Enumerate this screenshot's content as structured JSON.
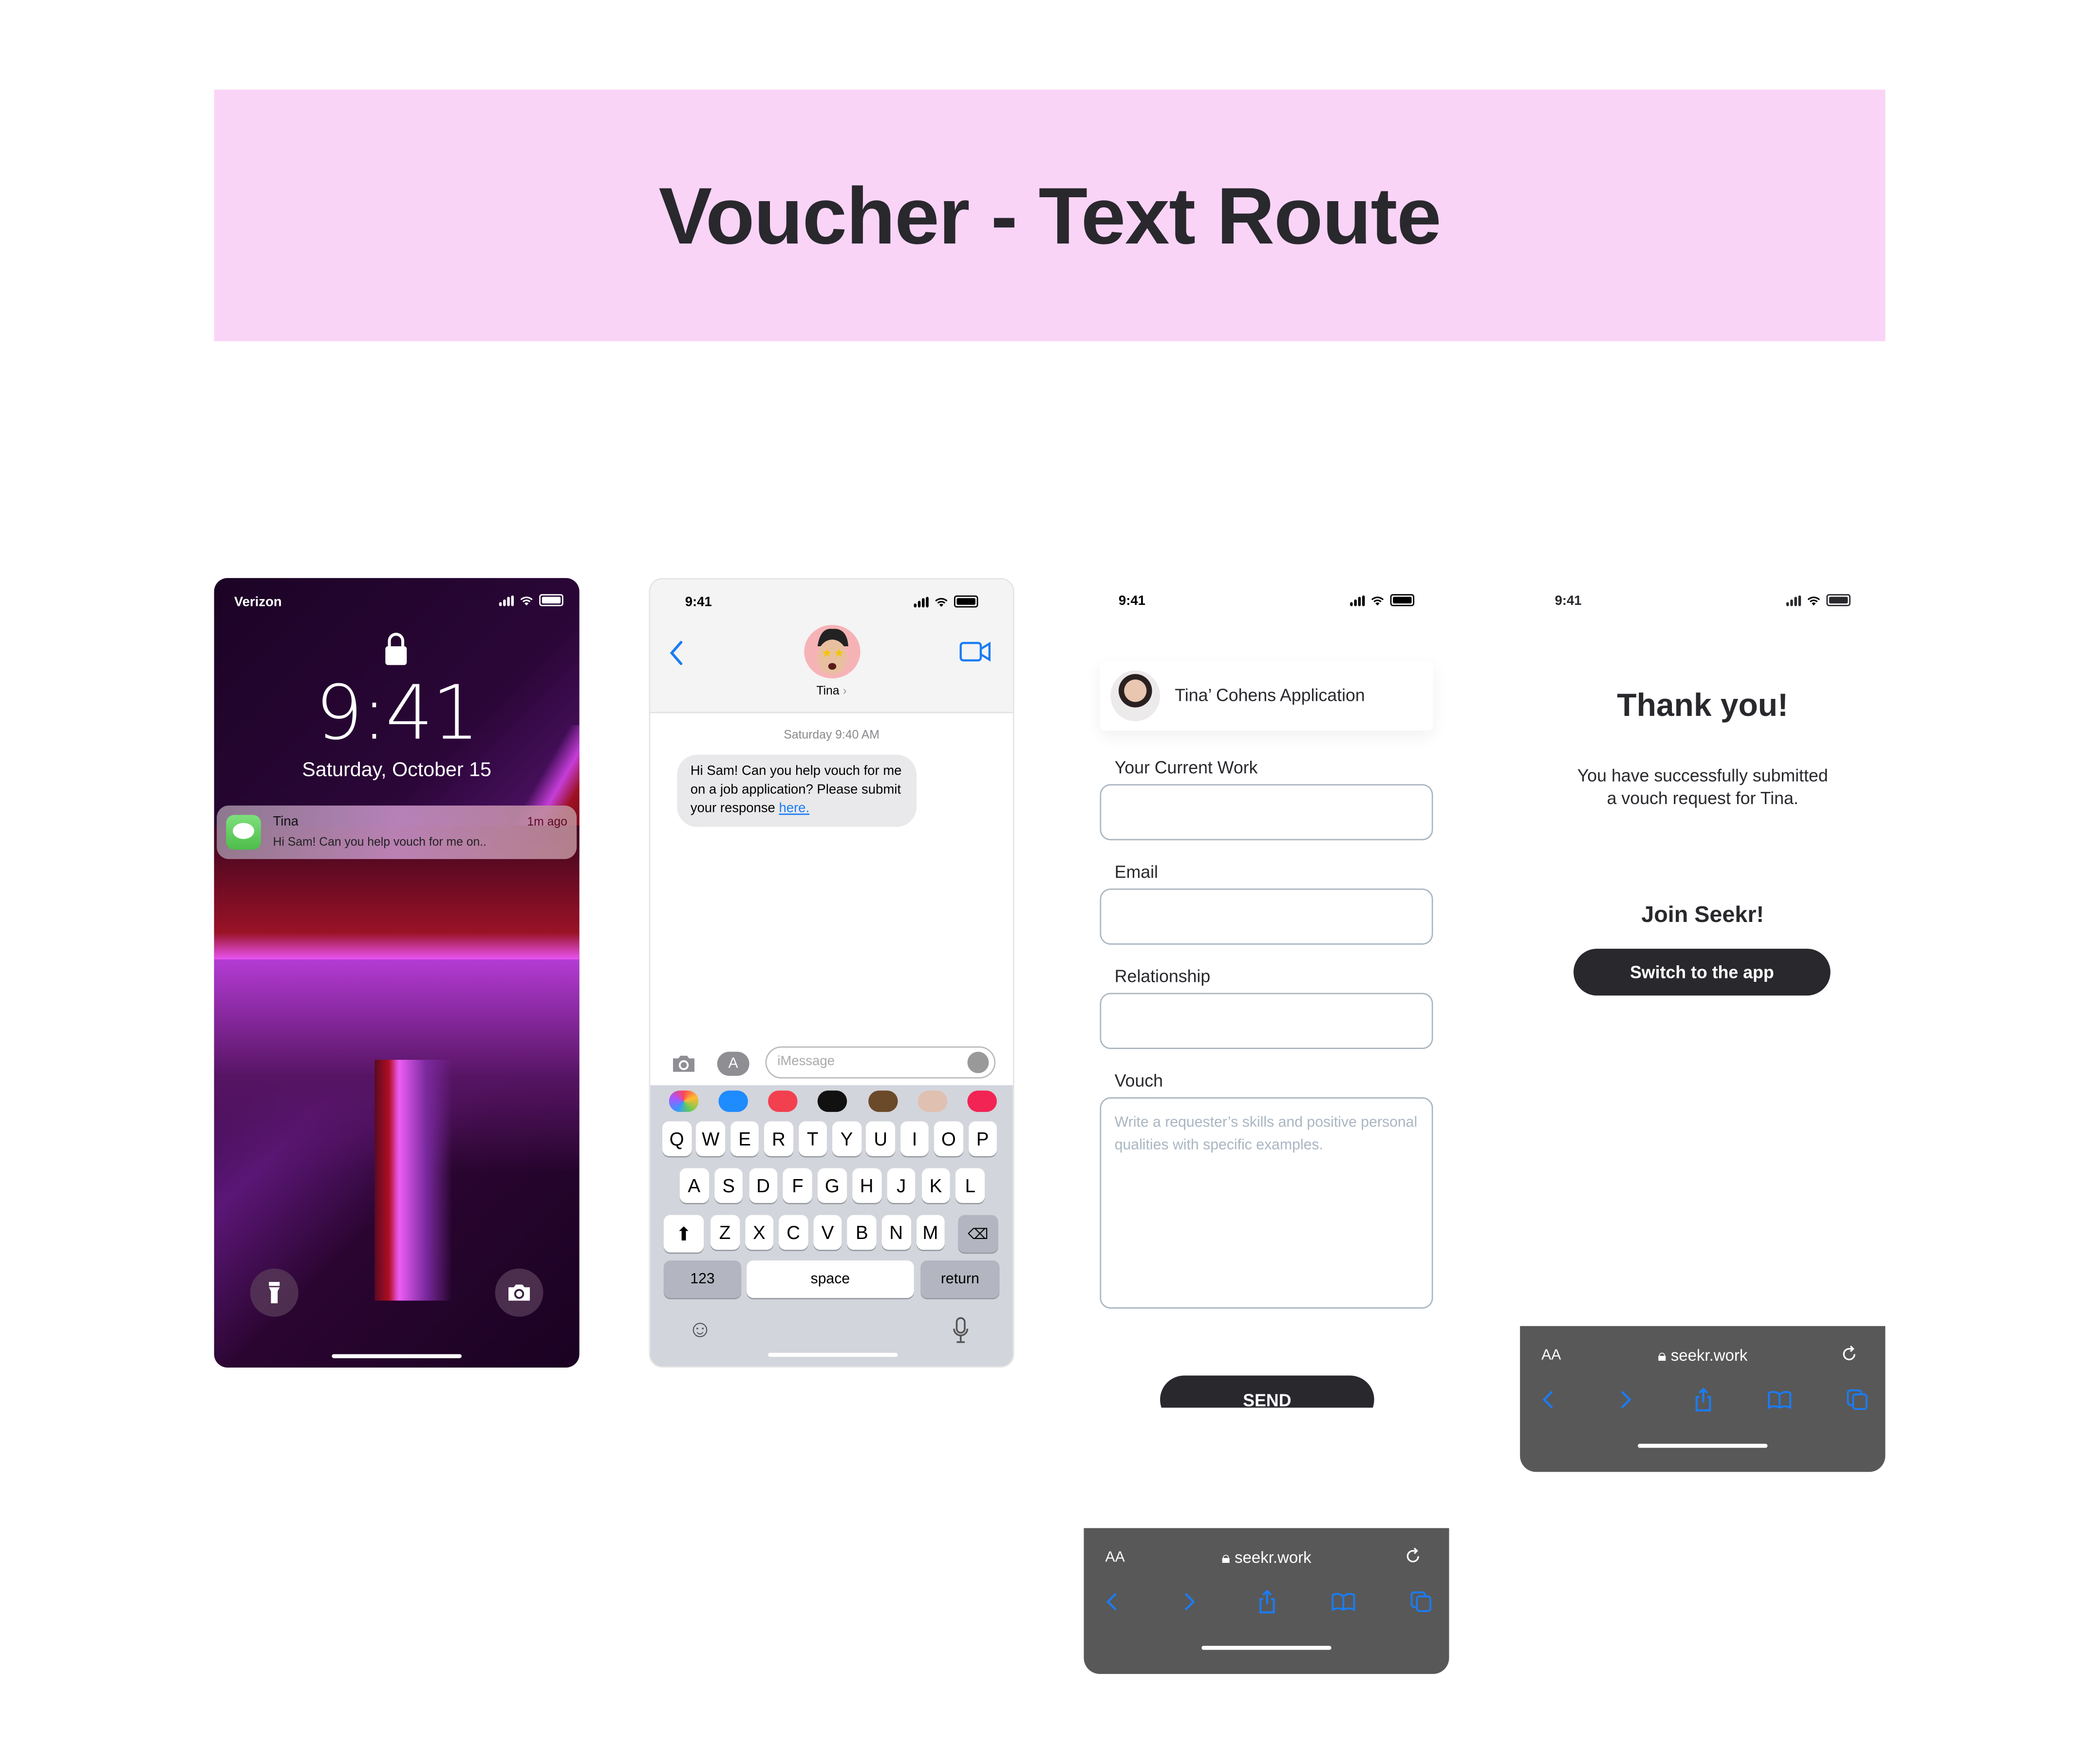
{
  "banner": {
    "title": "Voucher - Text Route",
    "color": "#fad4f7"
  },
  "status": {
    "time": "9:41"
  },
  "lock_screen": {
    "carrier": "Verizon",
    "time": "9:41",
    "date": "Saturday, October 15",
    "notification": {
      "app_icon": "messages-icon",
      "sender": "Tina",
      "preview": "Hi Sam! Can you help vouch for me on..",
      "time_ago": "1m ago"
    },
    "buttons": [
      "flashlight-icon",
      "camera-icon"
    ]
  },
  "messages": {
    "contact_name": "Tina",
    "timestamp": "Saturday 9:40 AM",
    "bubble_text": "Hi Sam! Can you help vouch for me on a job application? Please submit your response ",
    "bubble_link": "here.",
    "input_placeholder": "iMessage",
    "accent": "#1a7cf5",
    "keyboard": {
      "row1": [
        "Q",
        "W",
        "E",
        "R",
        "T",
        "Y",
        "U",
        "I",
        "O",
        "P"
      ],
      "row2": [
        "A",
        "S",
        "D",
        "F",
        "G",
        "H",
        "J",
        "K",
        "L"
      ],
      "row3": [
        "Z",
        "X",
        "C",
        "V",
        "B",
        "N",
        "M"
      ],
      "numbers": "123",
      "space": "space",
      "return": "return"
    },
    "app_strip": [
      "photos-icon",
      "app-store-icon",
      "music-icon",
      "apple-pay-icon",
      "memoji-icon",
      "animoji-icon",
      "search-images-icon"
    ]
  },
  "form": {
    "card_title": "Tina’ Cohens Application",
    "fields": [
      {
        "label": "Your Current Work",
        "value": "",
        "placeholder": ""
      },
      {
        "label": "Email",
        "value": "",
        "placeholder": ""
      },
      {
        "label": "Relationship",
        "value": "",
        "placeholder": ""
      },
      {
        "label": "Vouch",
        "value": "",
        "placeholder": "Write a requester’s skills and positive personal qualities with specific examples."
      }
    ],
    "send_label": "SEND"
  },
  "safari": {
    "aa": "AA",
    "url": "seekr.work"
  },
  "thanks": {
    "title": "Thank you!",
    "subtitle_line1": "You have successfully submitted",
    "subtitle_line2": "a vouch request for Tina.",
    "join": "Join Seekr!",
    "button": "Switch to the app"
  }
}
